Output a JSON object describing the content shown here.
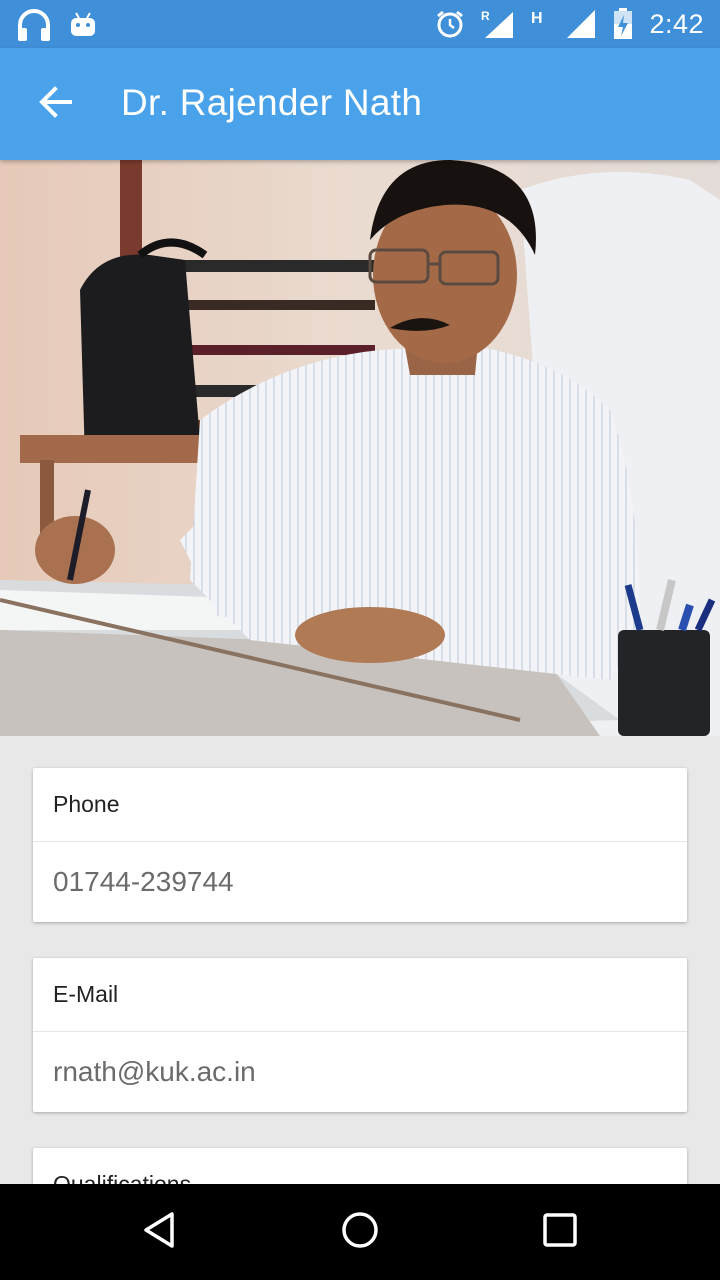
{
  "status_bar": {
    "time": "2:42",
    "icons": [
      "headphones-icon",
      "android-icon",
      "alarm-icon",
      "signal-roaming-icon",
      "network-h-icon",
      "signal-icon",
      "battery-charging-icon"
    ],
    "network_type": "H",
    "roaming_marker": "R"
  },
  "app_bar": {
    "title": "Dr. Rajender Nath",
    "back_icon": "arrow-back-icon",
    "color": "#4aa3ea"
  },
  "profile": {
    "photo": "profile-photo"
  },
  "cards": {
    "phone": {
      "label": "Phone",
      "value": "01744-239744"
    },
    "email": {
      "label": "E-Mail",
      "value": "rnath@kuk.ac.in"
    },
    "qualifications": {
      "label": "Qualifications"
    }
  },
  "nav_bar": {
    "back": "nav-back-icon",
    "home": "nav-home-icon",
    "recents": "nav-recents-icon"
  }
}
